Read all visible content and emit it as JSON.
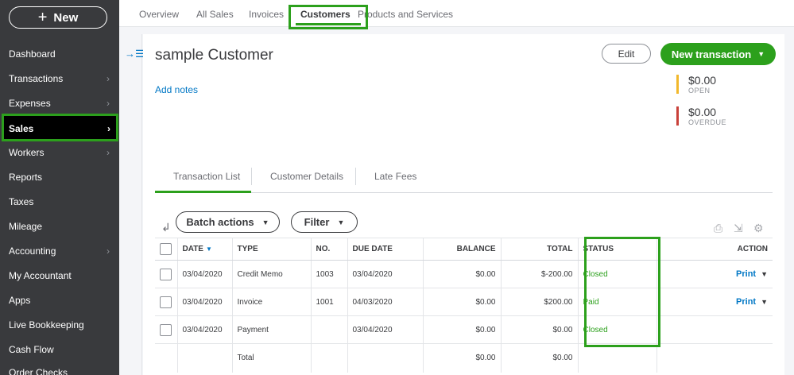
{
  "sidebar": {
    "new_label": "New",
    "items": [
      {
        "label": "Dashboard",
        "chevron": false
      },
      {
        "label": "Transactions",
        "chevron": true
      },
      {
        "label": "Expenses",
        "chevron": true
      },
      {
        "label": "Sales",
        "chevron": true,
        "active": true
      },
      {
        "label": "Workers",
        "chevron": true
      },
      {
        "label": "Reports",
        "chevron": false
      },
      {
        "label": "Taxes",
        "chevron": false
      },
      {
        "label": "Mileage",
        "chevron": false
      },
      {
        "label": "Accounting",
        "chevron": true
      },
      {
        "label": "My Accountant",
        "chevron": false
      },
      {
        "label": "Apps",
        "chevron": false
      },
      {
        "label": "Live Bookkeeping",
        "chevron": false
      },
      {
        "label": "Cash Flow",
        "chevron": false
      },
      {
        "label": "Order Checks",
        "chevron": false
      }
    ]
  },
  "top_tabs": [
    "Overview",
    "All Sales",
    "Invoices",
    "Customers",
    "Products and Services"
  ],
  "top_tabs_active": "Customers",
  "customer": {
    "name": "sample Customer",
    "add_notes": "Add notes",
    "edit_label": "Edit",
    "new_transaction_label": "New transaction",
    "open_amount": "$0.00",
    "open_label": "OPEN",
    "overdue_amount": "$0.00",
    "overdue_label": "OVERDUE"
  },
  "sub_tabs": [
    "Transaction List",
    "Customer Details",
    "Late Fees"
  ],
  "toolbar": {
    "batch_actions": "Batch actions",
    "filter": "Filter"
  },
  "table": {
    "headers": {
      "date": "DATE",
      "type": "TYPE",
      "no": "NO.",
      "due_date": "DUE DATE",
      "balance": "BALANCE",
      "total": "TOTAL",
      "status": "STATUS",
      "action": "ACTION"
    },
    "rows": [
      {
        "date": "03/04/2020",
        "type": "Credit Memo",
        "no": "1003",
        "due_date": "03/04/2020",
        "balance": "$0.00",
        "total": "$-200.00",
        "status": "Closed",
        "action": "Print"
      },
      {
        "date": "03/04/2020",
        "type": "Invoice",
        "no": "1001",
        "due_date": "04/03/2020",
        "balance": "$0.00",
        "total": "$200.00",
        "status": "Paid",
        "action": "Print"
      },
      {
        "date": "03/04/2020",
        "type": "Payment",
        "no": "",
        "due_date": "03/04/2020",
        "balance": "$0.00",
        "total": "$0.00",
        "status": "Closed",
        "action": ""
      }
    ],
    "total_row": {
      "label": "Total",
      "balance": "$0.00",
      "total": "$0.00"
    }
  },
  "colors": {
    "accent_green": "#2ca01c",
    "link_blue": "#0077c5",
    "open_bar": "#f2b82c",
    "overdue_bar": "#c9413a",
    "sidebar_bg": "#393a3d"
  }
}
